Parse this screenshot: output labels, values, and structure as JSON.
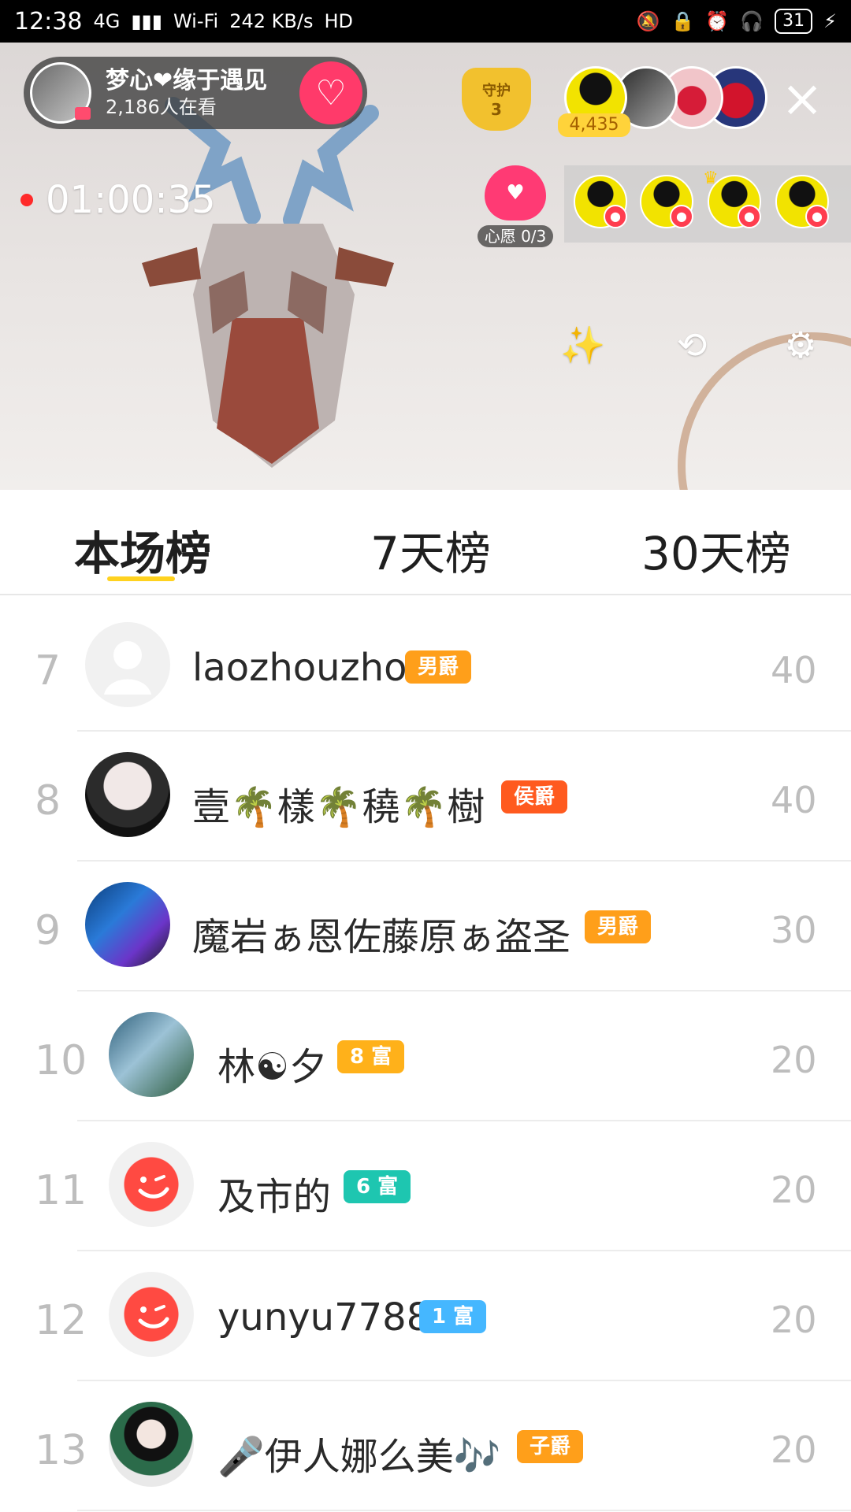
{
  "status_bar": {
    "time": "12:38",
    "network": "4G",
    "signal": "▮▮▮",
    "wifi": "Wi‑Fi",
    "speed": "242 KB/s",
    "hd": "HD",
    "icons": [
      "mute-icon",
      "lock-icon",
      "alarm-icon",
      "headset-icon"
    ],
    "battery": "31"
  },
  "live": {
    "host": {
      "name": "梦心❤缘于遇见",
      "viewers": "2,186人在看",
      "follow_icon": "heart-plus-icon"
    },
    "guard": {
      "label": "守护",
      "count": "3"
    },
    "top_score": "4,435",
    "timer": "01:00:35",
    "wish": {
      "label": "心愿 0/3"
    },
    "tools": {
      "magic": "✨",
      "camera": "⟲",
      "settings": "⚙"
    },
    "close_icon": "×"
  },
  "tabs": [
    {
      "label": "本场榜",
      "active": true
    },
    {
      "label": "7天榜",
      "active": false
    },
    {
      "label": "30天榜",
      "active": false
    }
  ],
  "leaderboard": [
    {
      "rank": "7",
      "name": "laozhouzho",
      "badge": "男爵",
      "badge_color": "#ff9f1a",
      "score": "40",
      "avatar": "placeholder"
    },
    {
      "rank": "8",
      "name": "壹🌴樣🌴穘🌴樹",
      "badge": "侯爵",
      "badge_color": "#ff5a1f",
      "score": "40",
      "avatar": "anime"
    },
    {
      "rank": "9",
      "name": "魔岩ぁ恩佐藤原ぁ盗圣",
      "badge": "男爵",
      "badge_color": "#ff9f1a",
      "score": "30",
      "avatar": "car"
    },
    {
      "rank": "10",
      "name": "林☯夕",
      "badge": "8 富",
      "badge_color": "#ffb11a",
      "score": "20",
      "avatar": "landscape"
    },
    {
      "rank": "11",
      "name": "及市的",
      "badge": "6 富",
      "badge_color": "#1ec6b0",
      "score": "20",
      "avatar": "red-face"
    },
    {
      "rank": "12",
      "name": "yunyu7788",
      "badge": "1 富",
      "badge_color": "#45b7ff",
      "score": "20",
      "avatar": "red-face"
    },
    {
      "rank": "13",
      "name": "🎤伊人娜么美🎶",
      "badge": "子爵",
      "badge_color": "#ff9f1a",
      "score": "20",
      "avatar": "woman"
    }
  ]
}
